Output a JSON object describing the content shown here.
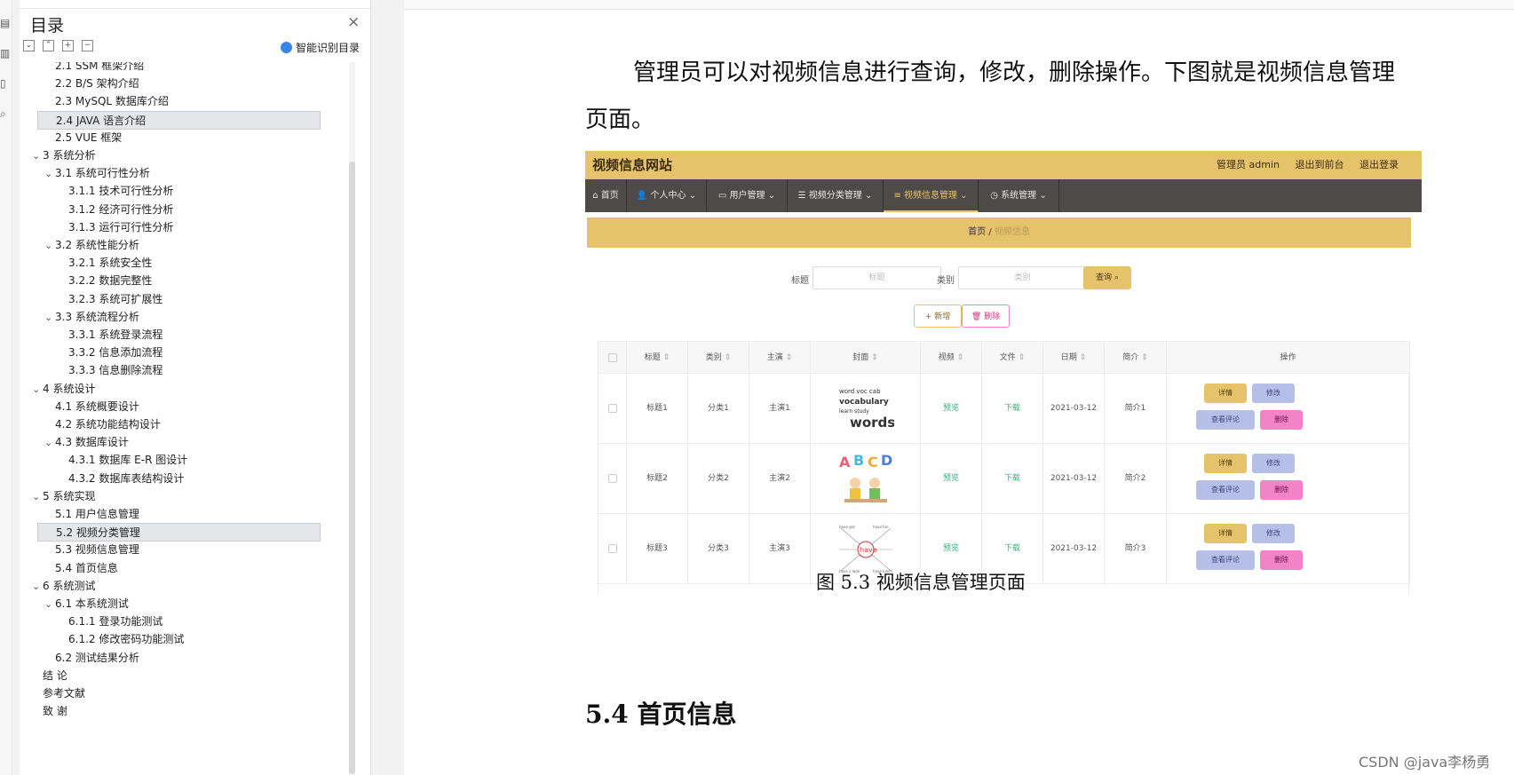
{
  "toc": {
    "title": "目录",
    "smart_label": "智能识别目录",
    "items": [
      {
        "label": "2.1 SSM 框架介绍",
        "level": 2,
        "chev": ""
      },
      {
        "label": "2.2 B/S 架构介绍",
        "level": 2,
        "chev": ""
      },
      {
        "label": "2.3 MySQL 数据库介绍",
        "level": 2,
        "chev": ""
      },
      {
        "label": "2.4 JAVA 语言介绍",
        "level": 2,
        "chev": "",
        "sel": true
      },
      {
        "label": "2.5 VUE 框架",
        "level": 2,
        "chev": ""
      },
      {
        "label": "3  系统分析",
        "level": 1,
        "chev": "⌄"
      },
      {
        "label": "3.1 系统可行性分析",
        "level": 2,
        "chev": "⌄"
      },
      {
        "label": "3.1.1  技术可行性分析",
        "level": 3,
        "chev": ""
      },
      {
        "label": "3.1.2  经济可行性分析",
        "level": 3,
        "chev": ""
      },
      {
        "label": "3.1.3  运行可行性分析",
        "level": 3,
        "chev": ""
      },
      {
        "label": "3.2 系统性能分析",
        "level": 2,
        "chev": "⌄"
      },
      {
        "label": "3.2.1  系统安全性",
        "level": 3,
        "chev": ""
      },
      {
        "label": "3.2.2  数据完整性",
        "level": 3,
        "chev": ""
      },
      {
        "label": "3.2.3 系统可扩展性",
        "level": 3,
        "chev": ""
      },
      {
        "label": "3.3 系统流程分析",
        "level": 2,
        "chev": "⌄"
      },
      {
        "label": "3.3.1 系统登录流程",
        "level": 3,
        "chev": ""
      },
      {
        "label": "3.3.2 信息添加流程",
        "level": 3,
        "chev": ""
      },
      {
        "label": "3.3.3 信息删除流程",
        "level": 3,
        "chev": ""
      },
      {
        "label": "4  系统设计",
        "level": 1,
        "chev": "⌄"
      },
      {
        "label": "4.1 系统概要设计",
        "level": 2,
        "chev": ""
      },
      {
        "label": "4.2 系统功能结构设计",
        "level": 2,
        "chev": ""
      },
      {
        "label": "4.3 数据库设计",
        "level": 2,
        "chev": "⌄"
      },
      {
        "label": "4.3.1 数据库 E-R 图设计",
        "level": 3,
        "chev": ""
      },
      {
        "label": "4.3.2  数据库表结构设计",
        "level": 3,
        "chev": ""
      },
      {
        "label": "5  系统实现",
        "level": 1,
        "chev": "⌄"
      },
      {
        "label": "5.1  用户信息管理",
        "level": 2,
        "chev": ""
      },
      {
        "label": "5.2  视频分类管理",
        "level": 2,
        "chev": "",
        "sel": true
      },
      {
        "label": "5.3  视频信息管理",
        "level": 2,
        "chev": ""
      },
      {
        "label": "5.4  首页信息",
        "level": 2,
        "chev": ""
      },
      {
        "label": "6 系统测试",
        "level": 1,
        "chev": "⌄"
      },
      {
        "label": "6.1  本系统测试",
        "level": 2,
        "chev": "⌄"
      },
      {
        "label": "6.1.1 登录功能测试",
        "level": 3,
        "chev": ""
      },
      {
        "label": "6.1.2 修改密码功能测试",
        "level": 3,
        "chev": ""
      },
      {
        "label": "6.2 测试结果分析",
        "level": 2,
        "chev": ""
      },
      {
        "label": "结    论",
        "level": 1,
        "chev": ""
      },
      {
        "label": "参考文献",
        "level": 1,
        "chev": ""
      },
      {
        "label": "致    谢",
        "level": 1,
        "chev": ""
      }
    ]
  },
  "doc": {
    "para_line1": "管理员可以对视频信息进行查询，修改，删除操作。下图就是视频信息管理",
    "para_line2": "页面。",
    "caption": "图 5.3  视频信息管理页面",
    "section": "5.4  首页信息",
    "watermark": "CSDN @java李杨勇"
  },
  "shot": {
    "site_name": "视频信息网站",
    "header_links": [
      "管理员 admin",
      "退出到前台",
      "退出登录"
    ],
    "nav": [
      "首页",
      "个人中心",
      "用户管理",
      "视频分类管理",
      "视频信息管理",
      "系统管理"
    ],
    "crumb_home": "首页",
    "crumb_sep": "/",
    "crumb_current": "视频信息",
    "search_title_label": "标题",
    "search_title_placeholder": "标题",
    "search_cat_label": "类别",
    "search_cat_placeholder": "类别",
    "query_btn": "查询",
    "add_btn": "+ 新增",
    "delete_btn": "删除",
    "columns": [
      "标题",
      "类别",
      "主演",
      "封面",
      "视频",
      "文件",
      "日期",
      "简介",
      "操作"
    ],
    "rows": [
      {
        "title": "标题1",
        "cat": "分类1",
        "star": "主演1",
        "video": "预览",
        "file": "下载",
        "date": "2021-03-12",
        "intro": "简介1"
      },
      {
        "title": "标题2",
        "cat": "分类2",
        "star": "主演2",
        "video": "预览",
        "file": "下载",
        "date": "2021-03-12",
        "intro": "简介2"
      },
      {
        "title": "标题3",
        "cat": "分类3",
        "star": "主演3",
        "video": "预览",
        "file": "下载",
        "date": "2021-03-12",
        "intro": "简介3"
      }
    ],
    "actions": {
      "detail": "详情",
      "edit": "修改",
      "comments": "查看评论",
      "delete": "删除"
    },
    "cover_words": [
      "words",
      "A B C D",
      "have"
    ]
  },
  "colors": {
    "accent": "#e6c36b",
    "nav": "#4d4a47",
    "delete": "#f283c6",
    "edit": "#b6bfe8"
  }
}
